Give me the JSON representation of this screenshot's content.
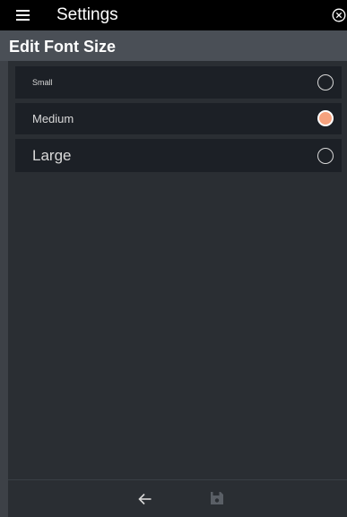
{
  "appbar": {
    "title": "Settings",
    "menu_icon": "hamburger-menu-icon",
    "close_icon": "close-circle-icon"
  },
  "section": {
    "title": "Edit Font Size"
  },
  "options": [
    {
      "label": "Small",
      "selected": false
    },
    {
      "label": "Medium",
      "selected": true
    },
    {
      "label": "Large",
      "selected": false
    }
  ],
  "toolbar": {
    "back_icon": "arrow-left-icon",
    "save_icon": "save-disk-icon"
  },
  "colors": {
    "background": "#2a2e33",
    "appbar": "#000000",
    "section_header": "#4a4f56",
    "option_background": "#1c2026",
    "radio_selected": "#f6a27e",
    "save_disabled": "#5a5f66"
  }
}
